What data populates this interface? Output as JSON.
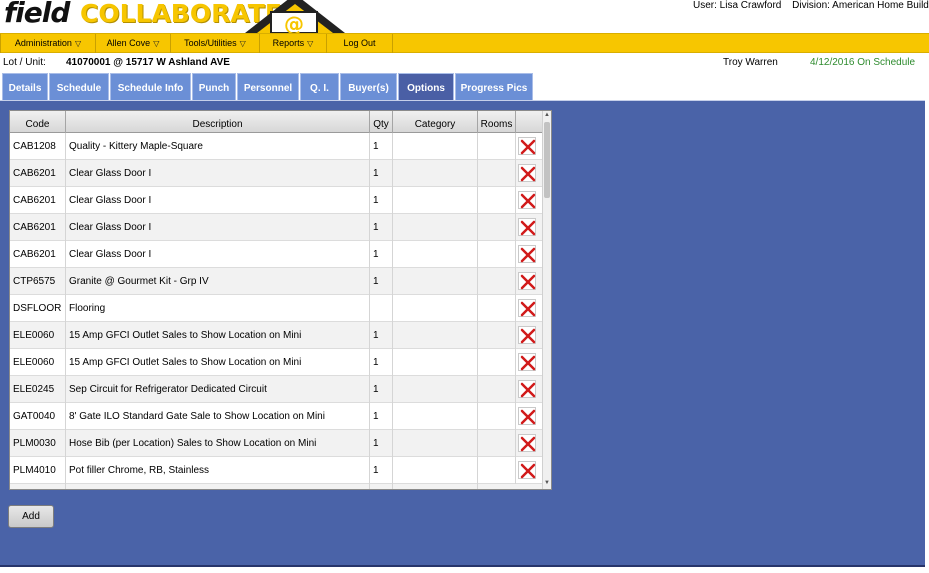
{
  "header": {
    "logo_field": "field",
    "logo_collaborate": "COLLABORATE",
    "user": "User: Lisa Crawford",
    "division": "Division: American Home Builders"
  },
  "nav": [
    {
      "label": "Administration",
      "dropdown": true
    },
    {
      "label": "Allen Cove",
      "dropdown": true
    },
    {
      "label": "Tools/Utilities",
      "dropdown": true
    },
    {
      "label": "Reports",
      "dropdown": true
    },
    {
      "label": "Log Out",
      "dropdown": false
    }
  ],
  "lot": {
    "label": "Lot / Unit:",
    "value": "41070001 @ 15717 W Ashland AVE",
    "person": "Troy Warren",
    "status": "4/12/2016 On Schedule"
  },
  "tabs": [
    {
      "label": "Details"
    },
    {
      "label": "Schedule"
    },
    {
      "label": "Schedule Info"
    },
    {
      "label": "Punch"
    },
    {
      "label": "Personnel"
    },
    {
      "label": "Q. I."
    },
    {
      "label": "Buyer(s)"
    },
    {
      "label": "Options",
      "active": true
    },
    {
      "label": "Progress Pics"
    }
  ],
  "grid": {
    "columns": [
      "Code",
      "Description",
      "Qty",
      "Category",
      "Rooms"
    ],
    "rows": [
      {
        "code": "CAB1208",
        "description": "Quality - Kittery Maple-Square",
        "qty": "1",
        "category": "",
        "rooms": ""
      },
      {
        "code": "CAB6201",
        "description": "Clear Glass Door I",
        "qty": "1",
        "category": "",
        "rooms": ""
      },
      {
        "code": "CAB6201",
        "description": "Clear Glass Door I",
        "qty": "1",
        "category": "",
        "rooms": ""
      },
      {
        "code": "CAB6201",
        "description": "Clear Glass Door I",
        "qty": "1",
        "category": "",
        "rooms": ""
      },
      {
        "code": "CAB6201",
        "description": "Clear Glass Door I",
        "qty": "1",
        "category": "",
        "rooms": ""
      },
      {
        "code": "CTP6575",
        "description": "Granite @ Gourmet Kit - Grp IV",
        "qty": "1",
        "category": "",
        "rooms": ""
      },
      {
        "code": "DSFLOOR",
        "description": "Flooring",
        "qty": "",
        "category": "",
        "rooms": ""
      },
      {
        "code": "ELE0060",
        "description": "15 Amp GFCI Outlet Sales to Show Location on Mini",
        "qty": "1",
        "category": "",
        "rooms": ""
      },
      {
        "code": "ELE0060",
        "description": "15 Amp GFCI Outlet Sales to Show Location on Mini",
        "qty": "1",
        "category": "",
        "rooms": ""
      },
      {
        "code": "ELE0245",
        "description": "Sep Circuit for Refrigerator Dedicated Circuit",
        "qty": "1",
        "category": "",
        "rooms": ""
      },
      {
        "code": "GAT0040",
        "description": "8' Gate ILO Standard Gate Sale to Show Location on Mini",
        "qty": "1",
        "category": "",
        "rooms": ""
      },
      {
        "code": "PLM0030",
        "description": "Hose Bib (per Location) Sales to Show Location on Mini",
        "qty": "1",
        "category": "",
        "rooms": ""
      },
      {
        "code": "PLM4010",
        "description": "Pot filler Chrome, RB, Stainless",
        "qty": "1",
        "category": "",
        "rooms": ""
      }
    ]
  },
  "add_button": "Add",
  "colors": {
    "nav_bg": "#f7c600",
    "tab_bg": "#6b8fd6",
    "tab_active_bg": "#4a5fa5",
    "content_bg": "#4a63a8",
    "status_green": "#2e8b2e",
    "delete_red": "#d11a1a"
  },
  "icons": {
    "delete": "delete-x-icon",
    "nav_dropdown": "chevron-down-icon"
  }
}
